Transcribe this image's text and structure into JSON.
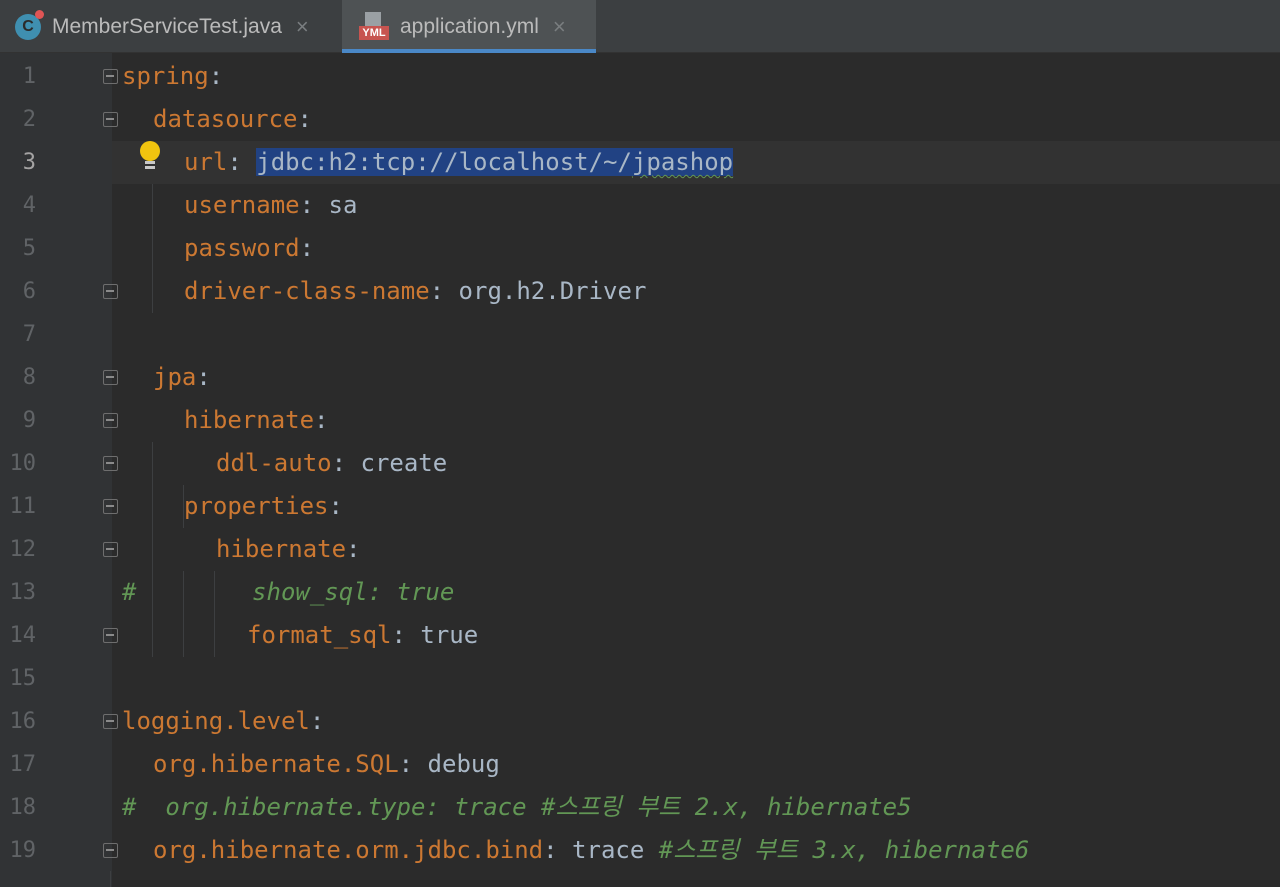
{
  "tabs": [
    {
      "label": "MemberServiceTest.java",
      "icon": "java-class-icon",
      "active": false,
      "icon_letter": "C"
    },
    {
      "label": "application.yml",
      "icon": "yaml-file-icon",
      "active": true,
      "icon_text": "YML"
    }
  ],
  "tab_close_glyph": "×",
  "gutter": {
    "line_numbers": [
      "1",
      "2",
      "3",
      "4",
      "5",
      "6",
      "7",
      "8",
      "9",
      "10",
      "11",
      "12",
      "13",
      "14",
      "15",
      "16",
      "17",
      "18",
      "19"
    ],
    "current_line": "3"
  },
  "editor": {
    "lines": [
      {
        "n": "1",
        "k": "spring",
        "p": ":",
        "v": ""
      },
      {
        "n": "2",
        "k": "datasource",
        "p": ":",
        "v": ""
      },
      {
        "n": "3",
        "k": "url",
        "p": ": ",
        "v_sel_a": "jdbc:h2:tcp://localhost/~/",
        "v_sel_b": "jpashop"
      },
      {
        "n": "4",
        "k": "username",
        "p": ": ",
        "v": "sa"
      },
      {
        "n": "5",
        "k": "password",
        "p": ":",
        "v": ""
      },
      {
        "n": "6",
        "k": "driver-class-name",
        "p": ": ",
        "v": "org.h2.Driver"
      },
      {
        "n": "8",
        "k": "jpa",
        "p": ":",
        "v": ""
      },
      {
        "n": "9",
        "k": "hibernate",
        "p": ":",
        "v": ""
      },
      {
        "n": "10",
        "k": "ddl-auto",
        "p": ": ",
        "v": "create"
      },
      {
        "n": "11",
        "k": "properties",
        "p": ":",
        "v": ""
      },
      {
        "n": "12",
        "k": "hibernate",
        "p": ":",
        "v": ""
      },
      {
        "n": "13",
        "comment": "#        show_sql: true"
      },
      {
        "n": "14",
        "k": "format_sql",
        "p": ": ",
        "v": "true"
      },
      {
        "n": "16",
        "k": "logging.level",
        "p": ":",
        "v": ""
      },
      {
        "n": "17",
        "k": "org.hibernate.SQL",
        "p": ": ",
        "v": "debug"
      },
      {
        "n": "18",
        "comment": "#  org.hibernate.type: trace #스프링 부트 2.x, hibernate5"
      },
      {
        "n": "19",
        "k": "org.hibernate.orm.jdbc.bind",
        "p": ": ",
        "v": "trace ",
        "c": "#스프링 부트 3.x, hibernate6"
      }
    ]
  },
  "colors": {
    "key": "#cc7832",
    "value": "#a9b7c6",
    "comment": "#629755",
    "selection": "#214283",
    "tab_accent": "#4a88c7"
  }
}
